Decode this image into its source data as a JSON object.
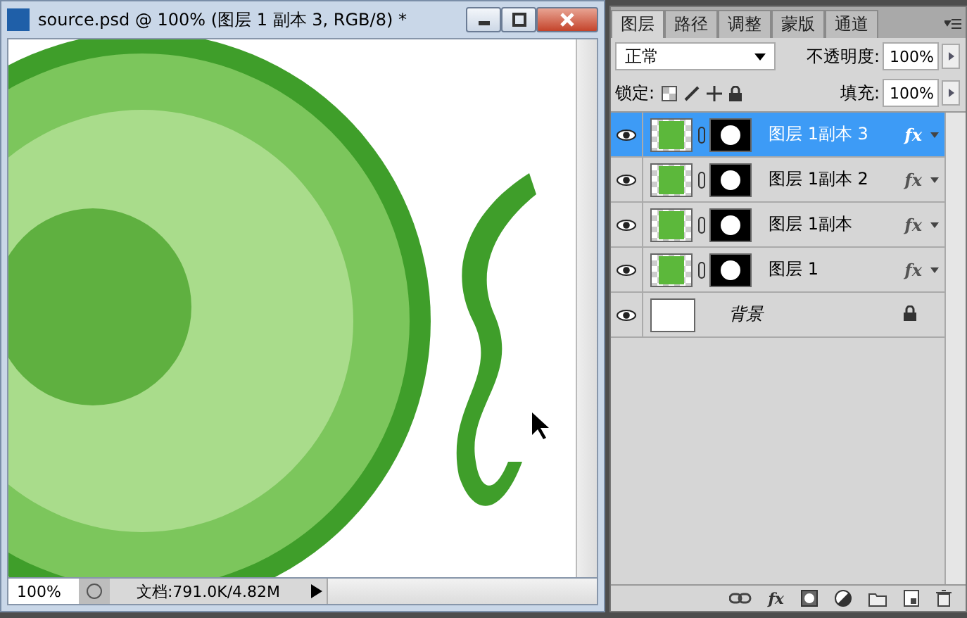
{
  "document_window": {
    "title": "source.psd @ 100% (图层 1 副本 3, RGB/8) *",
    "status_bar": {
      "zoom": "100%",
      "document_size": "文档:791.0K/4.82M"
    }
  },
  "layers_panel": {
    "tabs": [
      {
        "label": "图层",
        "selected": true
      },
      {
        "label": "路径",
        "selected": false
      },
      {
        "label": "调整",
        "selected": false
      },
      {
        "label": "蒙版",
        "selected": false
      },
      {
        "label": "通道",
        "selected": false
      }
    ],
    "blend_mode": "正常",
    "opacity_label": "不透明度:",
    "opacity": "100%",
    "lock_label": "锁定:",
    "fill_label": "填充:",
    "fill": "100%",
    "layers": [
      {
        "kind": "masked",
        "name": "图层 1副本 3",
        "selected": true,
        "visible": true,
        "fx": "fx",
        "locked": false
      },
      {
        "kind": "masked",
        "name": "图层 1副本 2",
        "selected": false,
        "visible": true,
        "fx": "fx",
        "locked": false
      },
      {
        "kind": "masked",
        "name": "图层 1副本",
        "selected": false,
        "visible": true,
        "fx": "fx",
        "locked": false
      },
      {
        "kind": "masked",
        "name": "图层 1",
        "selected": false,
        "visible": true,
        "fx": "fx",
        "locked": false
      },
      {
        "kind": "background",
        "name": "背景",
        "selected": false,
        "visible": true,
        "locked": true
      }
    ],
    "toolbar_fx": "fx"
  }
}
